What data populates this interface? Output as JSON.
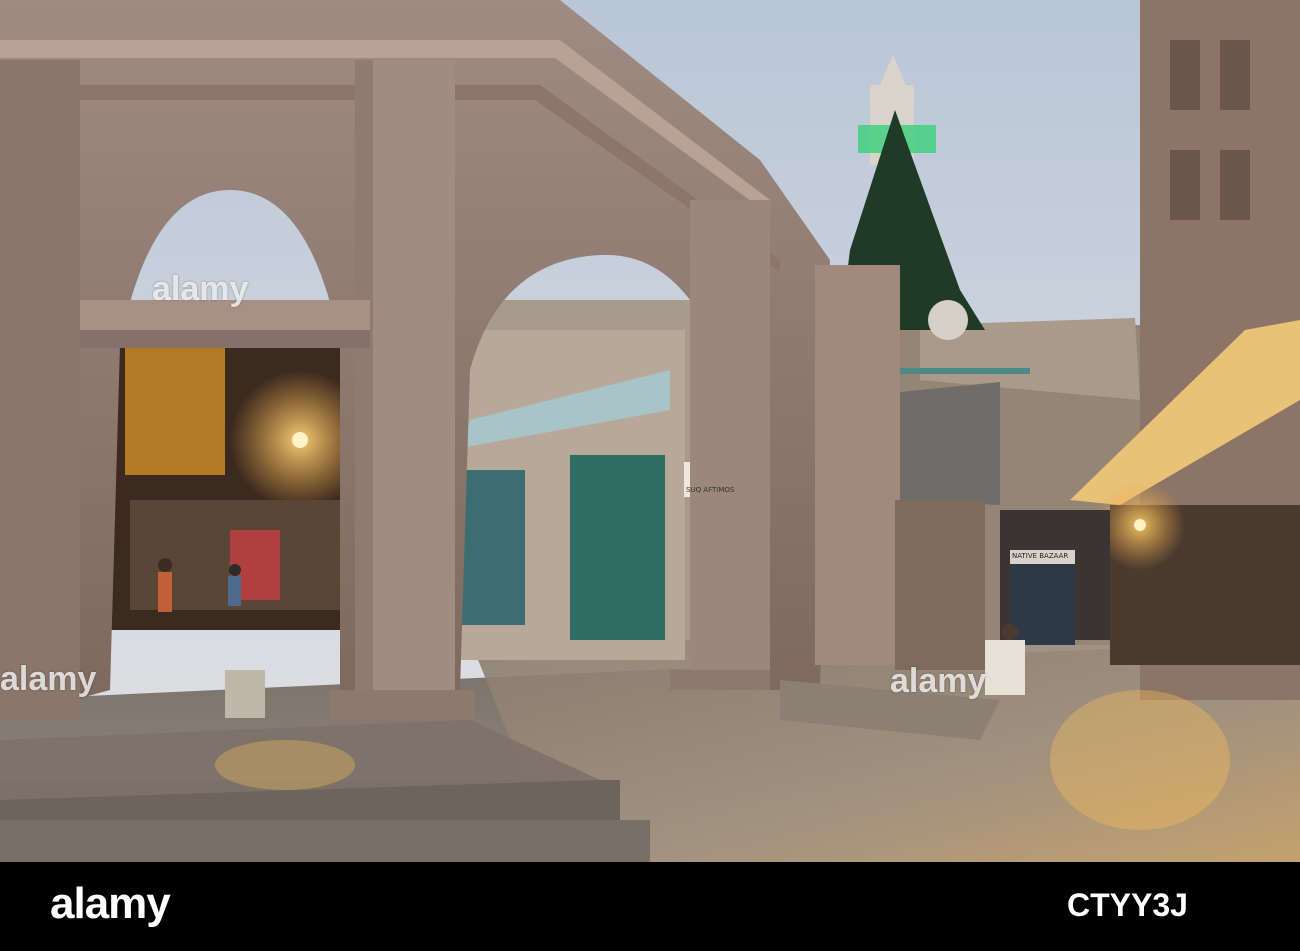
{
  "photo": {
    "icon": "street-scene-photo",
    "watermarks": {
      "top": "alamy",
      "middle": "alamy",
      "right": "alamy"
    },
    "signs": {
      "street_sign": "SUQ AFTIMOS",
      "shop_sign": "NATIVE BAZAAR"
    }
  },
  "banner": {
    "logo": "alamy",
    "stock_id": "CTYY3J"
  },
  "colors": {
    "sky": "#c9d3df",
    "stone": "#a88f82",
    "lamp": "#f3b03a",
    "banner": "#000000"
  }
}
